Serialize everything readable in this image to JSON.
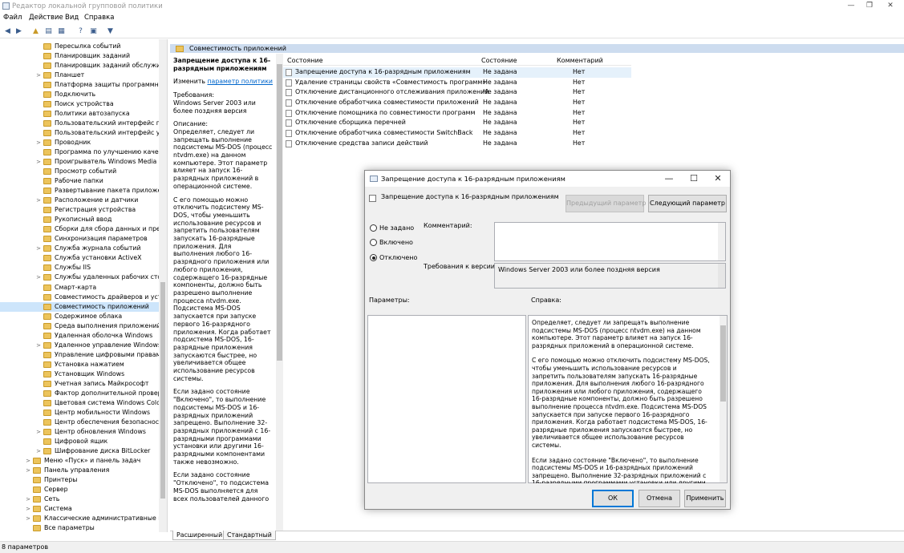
{
  "window": {
    "title": "Редактор локальной групповой политики",
    "controls": {
      "minimize": "—",
      "maximize": "❐",
      "close": "✕"
    }
  },
  "menu": [
    "Файл",
    "Действие",
    "Вид",
    "Справка"
  ],
  "tree": [
    {
      "label": "Пересылка событий",
      "indent": 2,
      "exp": ""
    },
    {
      "label": "Планировщик заданий",
      "indent": 2,
      "exp": ""
    },
    {
      "label": "Планировщик заданий обслужива",
      "indent": 2,
      "exp": ""
    },
    {
      "label": "Планшет",
      "indent": 2,
      "exp": ">"
    },
    {
      "label": "Платформа защиты программного",
      "indent": 2,
      "exp": ""
    },
    {
      "label": "Подключить",
      "indent": 2,
      "exp": ""
    },
    {
      "label": "Поиск устройства",
      "indent": 2,
      "exp": ""
    },
    {
      "label": "Политики автозапуска",
      "indent": 2,
      "exp": ""
    },
    {
      "label": "Пользовательский интерфейс гра",
      "indent": 2,
      "exp": ""
    },
    {
      "label": "Пользовательский интерфейс учет",
      "indent": 2,
      "exp": ""
    },
    {
      "label": "Проводник",
      "indent": 2,
      "exp": ">"
    },
    {
      "label": "Программа по улучшению качест",
      "indent": 2,
      "exp": ""
    },
    {
      "label": "Проигрыватель Windows Media",
      "indent": 2,
      "exp": ">"
    },
    {
      "label": "Просмотр событий",
      "indent": 2,
      "exp": ""
    },
    {
      "label": "Рабочие папки",
      "indent": 2,
      "exp": ""
    },
    {
      "label": "Развертывание пакета приложения",
      "indent": 2,
      "exp": ""
    },
    {
      "label": "Расположение и датчики",
      "indent": 2,
      "exp": ">"
    },
    {
      "label": "Регистрация устройства",
      "indent": 2,
      "exp": ""
    },
    {
      "label": "Рукописный ввод",
      "indent": 2,
      "exp": ""
    },
    {
      "label": "Сборки для сбора данных и предв",
      "indent": 2,
      "exp": ""
    },
    {
      "label": "Синхронизация параметров",
      "indent": 2,
      "exp": ""
    },
    {
      "label": "Служба журнала событий",
      "indent": 2,
      "exp": ">"
    },
    {
      "label": "Служба установки ActiveX",
      "indent": 2,
      "exp": ""
    },
    {
      "label": "Службы IIS",
      "indent": 2,
      "exp": ""
    },
    {
      "label": "Службы удаленных рабочих столо",
      "indent": 2,
      "exp": ">"
    },
    {
      "label": "Смарт-карта",
      "indent": 2,
      "exp": ""
    },
    {
      "label": "Совместимость драйверов и устро",
      "indent": 2,
      "exp": ""
    },
    {
      "label": "Совместимость приложений",
      "indent": 2,
      "exp": "",
      "selected": true
    },
    {
      "label": "Содержимое облака",
      "indent": 2,
      "exp": ""
    },
    {
      "label": "Среда выполнения приложений",
      "indent": 2,
      "exp": ""
    },
    {
      "label": "Удаленная оболочка Windows",
      "indent": 2,
      "exp": ""
    },
    {
      "label": "Удаленное управление Windows",
      "indent": 2,
      "exp": ">"
    },
    {
      "label": "Управление цифровыми правами",
      "indent": 2,
      "exp": ""
    },
    {
      "label": "Установка нажатием",
      "indent": 2,
      "exp": ""
    },
    {
      "label": "Установщик Windows",
      "indent": 2,
      "exp": ""
    },
    {
      "label": "Учетная запись Майкрософт",
      "indent": 2,
      "exp": ""
    },
    {
      "label": "Фактор дополнительной проверки",
      "indent": 2,
      "exp": ""
    },
    {
      "label": "Цветовая система Windows Color S",
      "indent": 2,
      "exp": ""
    },
    {
      "label": "Центр мобильности Windows",
      "indent": 2,
      "exp": ""
    },
    {
      "label": "Центр обеспечения безопасности",
      "indent": 2,
      "exp": ""
    },
    {
      "label": "Центр обновления Windows",
      "indent": 2,
      "exp": ">"
    },
    {
      "label": "Цифровой ящик",
      "indent": 2,
      "exp": ""
    },
    {
      "label": "Шифрование диска BitLocker",
      "indent": 2,
      "exp": ">"
    },
    {
      "label": "Меню «Пуск» и панель задач",
      "indent": 1,
      "exp": ">"
    },
    {
      "label": "Панель управления",
      "indent": 1,
      "exp": ">"
    },
    {
      "label": "Принтеры",
      "indent": 1,
      "exp": ""
    },
    {
      "label": "Сервер",
      "indent": 1,
      "exp": ""
    },
    {
      "label": "Сеть",
      "indent": 1,
      "exp": ">"
    },
    {
      "label": "Система",
      "indent": 1,
      "exp": ">"
    },
    {
      "label": "Классические административные шаб",
      "indent": 1,
      "exp": ">"
    },
    {
      "label": "Все параметры",
      "indent": 1,
      "exp": ""
    }
  ],
  "main": {
    "header": "Совместимость приложений",
    "description": {
      "title": "Запрещение доступа к 16-разрядным приложениям",
      "edit_prefix": "Изменить ",
      "edit_link": "параметр политики",
      "requirements_label": "Требования:",
      "requirements": "Windows Server 2003 или более поздняя версия",
      "description_label": "Описание:",
      "p1": "Определяет, следует ли запрещать выполнение подсистемы MS-DOS (процесс ntvdm.exe) на данном компьютере. Этот параметр влияет на запуск 16-разрядных приложений в операционной системе.",
      "p2": "С его помощью можно отключить подсистему MS-DOS, чтобы уменьшить использование ресурсов и запретить пользователям запускать 16-разрядные приложения. Для выполнения любого 16-разрядного приложения или любого приложения, содержащего 16-разрядные компоненты, должно быть разрешено выполнение процесса ntvdm.exe. Подсистема MS-DOS запускается при запуске первого 16-разрядного приложения. Когда работает подсистема MS-DOS, 16-разрядные приложения запускаются быстрее, но увеличивается общее использование ресурсов системы.",
      "p3": "Если задано состояние \"Включено\", то выполнение подсистемы MS-DOS и 16-разрядных приложений запрещено. Выполнение 32-разрядных приложений с 16-разрядными программами установки или другими 16-разрядными компонентами также невозможно.",
      "p4": "Если задано состояние \"Отключено\", то подсистема MS-DOS выполняется для всех пользователей данного"
    },
    "columns": [
      "Состояние",
      "Состояние",
      "Комментарий"
    ],
    "rows": [
      {
        "name": "Запрещение доступа к 16-разрядным приложениям",
        "state": "Не задана",
        "comment": "Нет",
        "selected": true
      },
      {
        "name": "Удаление страницы свойств «Совместимость программ»",
        "state": "Не задана",
        "comment": "Нет"
      },
      {
        "name": "Отключение дистанционного отслеживания приложений",
        "state": "Не задана",
        "comment": "Нет"
      },
      {
        "name": "Отключение обработчика совместимости приложений",
        "state": "Не задана",
        "comment": "Нет"
      },
      {
        "name": "Отключение помощника по совместимости программ",
        "state": "Не задана",
        "comment": "Нет"
      },
      {
        "name": "Отключение сборщика перечней",
        "state": "Не задана",
        "comment": "Нет"
      },
      {
        "name": "Отключение обработчика совместимости SwitchBack",
        "state": "Не задана",
        "comment": "Нет"
      },
      {
        "name": "Отключение средства записи действий",
        "state": "Не задана",
        "comment": "Нет"
      }
    ],
    "tabs": [
      "Расширенный",
      "Стандартный"
    ]
  },
  "status": "8 параметров",
  "dialog": {
    "title": "Запрещение доступа к 16-разрядным приложениям",
    "subtitle": "Запрещение доступа к 16-разрядным приложениям",
    "prev_button": "Предыдущий параметр",
    "next_button": "Следующий параметр",
    "radio": [
      {
        "label": "Не задано",
        "checked": false
      },
      {
        "label": "Включено",
        "checked": false
      },
      {
        "label": "Отключено",
        "checked": true
      }
    ],
    "comment_label": "Комментарий:",
    "requirements_label": "Требования к версии:",
    "requirements_value": "Windows Server 2003 или более поздняя версия",
    "params_label": "Параметры:",
    "help_label": "Справка:",
    "help": [
      "Определяет, следует ли запрещать выполнение подсистемы MS-DOS (процесс ntvdm.exe) на данном компьютере. Этот параметр влияет на запуск 16-разрядных приложений в операционной системе.",
      "С его помощью можно отключить подсистему MS-DOS, чтобы уменьшить использование ресурсов и запретить пользователям запускать 16-разрядные приложения. Для выполнения любого 16-разрядного приложения или любого приложения, содержащего 16-разрядные компоненты, должно быть разрешено выполнение процесса ntvdm.exe. Подсистема MS-DOS запускается при запуске первого 16-разрядного приложения. Когда работает подсистема MS-DOS, 16-разрядные приложения запускаются быстрее, но увеличивается общее использование ресурсов системы.",
      "Если задано состояние \"Включено\", то выполнение подсистемы MS-DOS и 16-разрядных приложений запрещено. Выполнение 32-разрядных приложений с 16-разрядными программами установки или другими 16-разрядными компонентами также невозможно."
    ],
    "ok": "ОК",
    "cancel": "Отмена",
    "apply": "Применить"
  }
}
